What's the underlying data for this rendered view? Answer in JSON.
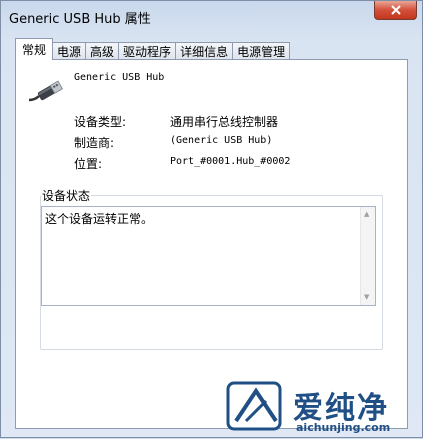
{
  "window": {
    "title": "Generic USB Hub 属性"
  },
  "tabs": [
    {
      "label": "常规",
      "active": true
    },
    {
      "label": "电源"
    },
    {
      "label": "高级"
    },
    {
      "label": "驱动程序"
    },
    {
      "label": "详细信息"
    },
    {
      "label": "电源管理"
    }
  ],
  "general": {
    "device_name": "Generic USB Hub",
    "properties": [
      {
        "label": "设备类型:",
        "value": "通用串行总线控制器"
      },
      {
        "label": "制造商:",
        "value": "(Generic USB Hub)"
      },
      {
        "label": "位置:",
        "value": "Port_#0001.Hub_#0002"
      }
    ],
    "status_title": "设备状态",
    "status_text": "这个设备运转正常。"
  },
  "icons": {
    "device": "usb-plug-icon",
    "close": "close-icon"
  },
  "watermark": {
    "brand": "爱纯净",
    "url": "aichunjing.com"
  },
  "colors": {
    "title_bg": "#c9d8ec",
    "close_red": "#c2351e",
    "watermark_blue": "#1f4f84"
  }
}
